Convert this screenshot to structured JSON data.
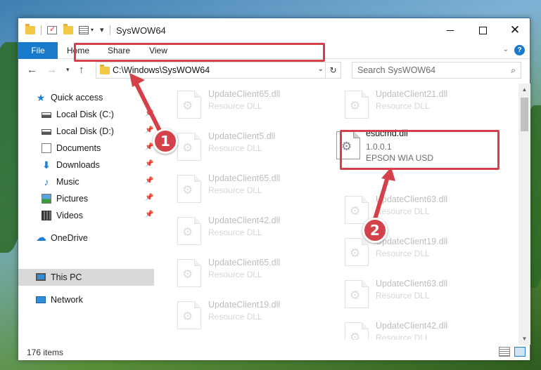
{
  "window": {
    "title": "SysWOW64"
  },
  "ribbon": {
    "tabs": [
      "File",
      "Home",
      "Share",
      "View"
    ],
    "help": "?"
  },
  "nav": {
    "address": "C:\\Windows\\SysWOW64",
    "search_placeholder": "Search SysWOW64"
  },
  "sidebar": {
    "items": [
      {
        "label": "Quick access",
        "icon": "star-icon"
      },
      {
        "label": "Local Disk (C:)",
        "icon": "drive-icon",
        "pinned": true
      },
      {
        "label": "Local Disk (D:)",
        "icon": "drive-icon",
        "pinned": true
      },
      {
        "label": "Documents",
        "icon": "document-icon",
        "pinned": true
      },
      {
        "label": "Downloads",
        "icon": "download-icon",
        "pinned": true
      },
      {
        "label": "Music",
        "icon": "music-icon",
        "pinned": true
      },
      {
        "label": "Pictures",
        "icon": "pictures-icon",
        "pinned": true
      },
      {
        "label": "Videos",
        "icon": "videos-icon",
        "pinned": true
      },
      {
        "label": "OneDrive",
        "icon": "cloud-icon"
      },
      {
        "label": "This PC",
        "icon": "computer-icon",
        "selected": true
      },
      {
        "label": "Network",
        "icon": "network-icon"
      }
    ]
  },
  "files": {
    "left_column": [
      {
        "name": "UpdateClient65.dll",
        "type": "Resource DLL"
      },
      {
        "name": "UpdateClient5.dll",
        "type": "Resource DLL"
      },
      {
        "name": "UpdateClient65.dll",
        "type": "Resource DLL"
      },
      {
        "name": "UpdateClient42.dll",
        "type": "Resource DLL"
      },
      {
        "name": "UpdateClient65.dll",
        "type": "Resource DLL"
      },
      {
        "name": "UpdateClient19.dll",
        "type": "Resource DLL"
      }
    ],
    "right_column": [
      {
        "name": "UpdateClient21.dll",
        "type": "Resource DLL"
      },
      {
        "name": "UpdateClient63.dll",
        "type": "Resource DLL"
      },
      {
        "name": "UpdateClient19.dll",
        "type": "Resource DLL"
      },
      {
        "name": "UpdateClient63.dll",
        "type": "Resource DLL"
      },
      {
        "name": "UpdateClient42.dll",
        "type": "Resource DLL"
      }
    ],
    "highlighted": {
      "name": "esucmd.dll",
      "version": "1.0.0.1",
      "description": "EPSON WIA USD"
    }
  },
  "status": {
    "item_count": "176 items"
  },
  "callouts": [
    "1",
    "2"
  ],
  "colors": {
    "accent": "#1979ca",
    "highlight": "#d5414b",
    "selected_bg": "#d9d9d9"
  }
}
